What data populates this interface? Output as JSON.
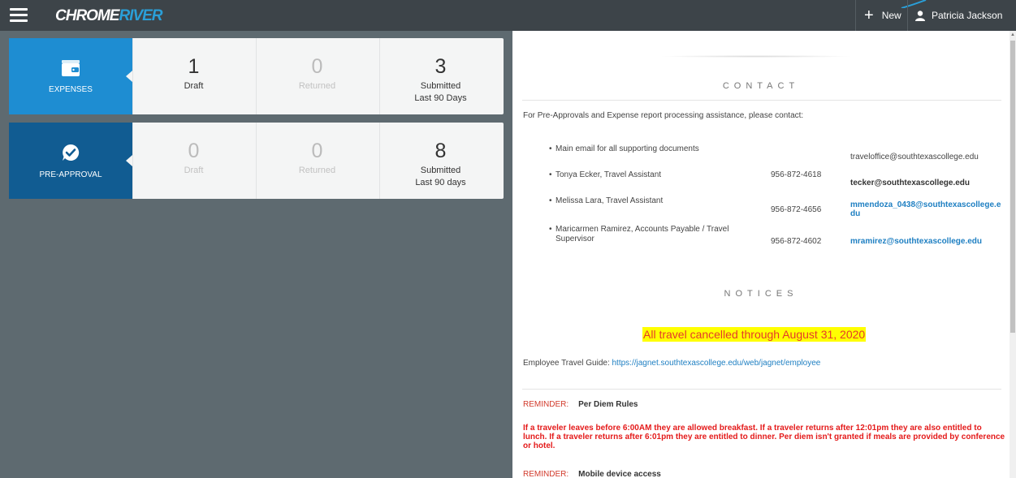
{
  "header": {
    "logo_part1": "CHROME",
    "logo_part2": "RIVER",
    "new_label": "New",
    "user_name": "Patricia Jackson"
  },
  "cards": [
    {
      "title": "EXPENSES",
      "icon": "wallet-icon",
      "stats": [
        {
          "value": "1",
          "caption": "Draft",
          "caption2": "",
          "active": true
        },
        {
          "value": "0",
          "caption": "Returned",
          "caption2": "",
          "active": false
        },
        {
          "value": "3",
          "caption": "Submitted",
          "caption2": "Last 90 Days",
          "active": true
        }
      ]
    },
    {
      "title": "PRE-APPROVAL",
      "icon": "checkmark-bubble-icon",
      "stats": [
        {
          "value": "0",
          "caption": "Draft",
          "caption2": "",
          "active": false
        },
        {
          "value": "0",
          "caption": "Returned",
          "caption2": "",
          "active": false
        },
        {
          "value": "8",
          "caption": "Submitted",
          "caption2": "Last 90 days",
          "active": true
        }
      ]
    }
  ],
  "panel": {
    "contact_title": "CONTACT",
    "contact_intro": "For Pre-Approvals and Expense report processing assistance, please contact:",
    "contacts": [
      {
        "name": "Main email for all supporting documents",
        "phone": "",
        "email": "traveloffice@southtexascollege.edu"
      },
      {
        "name": "Tonya Ecker, Travel Assistant",
        "phone": "956-872-4618",
        "email": "tecker@southtexascollege.edu"
      },
      {
        "name": "Melissa Lara, Travel Assistant",
        "phone": "956-872-4656",
        "email": "mmendoza_0438@southtexascollege.edu"
      },
      {
        "name": "Maricarmen Ramirez, Accounts Payable / Travel Supervisor",
        "phone": "956-872-4602",
        "email": "mramirez@southtexascollege.edu"
      }
    ],
    "notices_title": "NOTICES",
    "cancel_notice": "All travel cancelled through August 31, 2020",
    "guide_label": "Employee Travel Guide:",
    "guide_url": "https://jagnet.southtexascollege.edu/web/jagnet/employee",
    "reminders": [
      {
        "tag": "REMINDER:",
        "text": "Per Diem Rules"
      },
      {
        "tag": "REMINDER:",
        "text": "Mobile device access"
      }
    ],
    "per_diem_rule": "If a traveler leaves before 6:00AM they are allowed breakfast. If a traveler returns after 12:01pm they are also entitled to lunch. If a traveler returns after 6:01pm they are entitled to dinner. Per diem isn't granted if meals are provided by conference or hotel."
  }
}
